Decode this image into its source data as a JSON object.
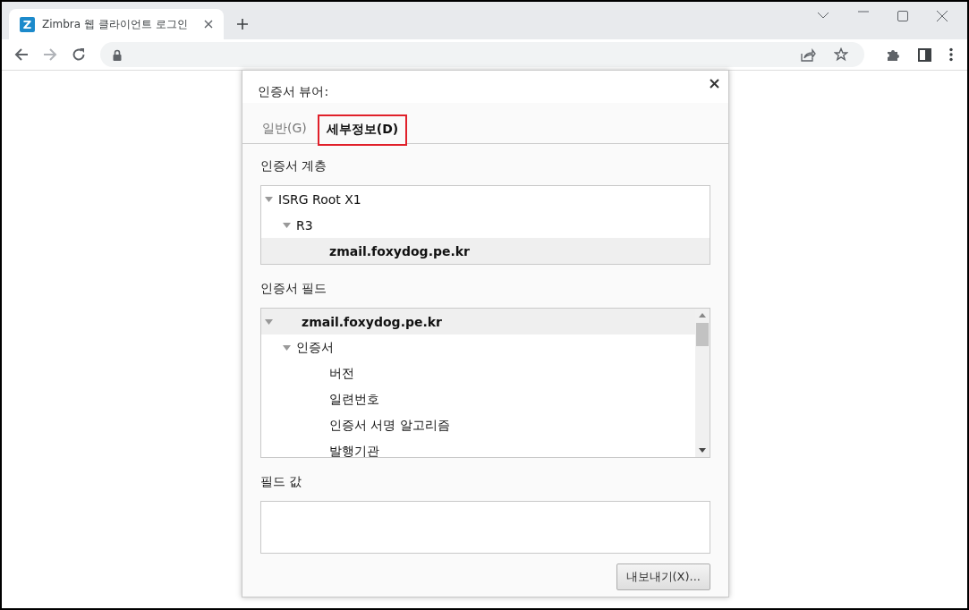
{
  "browser": {
    "tab": {
      "favicon": "Z",
      "title": "Zimbra 웹 클라이언트 로그인",
      "selected": true
    }
  },
  "dialog": {
    "title": "인증서 뷰어:",
    "tabs": [
      {
        "label": "일반(G)",
        "selected": false,
        "highlighted": false
      },
      {
        "label": "세부정보(D)",
        "selected": true,
        "highlighted": true
      }
    ],
    "hierarchy": {
      "label": "인증서 계층",
      "tree": [
        {
          "label": "ISRG Root X1",
          "expanded": true,
          "selected": false,
          "children": [
            {
              "label": "R3",
              "expanded": true,
              "selected": false,
              "children": [
                {
                  "label": "zmail.foxydog.pe.kr",
                  "selected": true
                }
              ]
            }
          ]
        }
      ]
    },
    "fields": {
      "label": "인증서 필드",
      "tree": [
        {
          "label": "zmail.foxydog.pe.kr",
          "expanded": true,
          "selected": true,
          "children": [
            {
              "label": "인증서",
              "expanded": true,
              "selected": false,
              "children": [
                {
                  "label": "버전",
                  "selected": false
                },
                {
                  "label": "일련번호",
                  "selected": false
                },
                {
                  "label": "인증서 서명 알고리즘",
                  "selected": false
                },
                {
                  "label": "발행기관",
                  "selected": false
                }
              ]
            }
          ]
        }
      ]
    },
    "value": {
      "label": "필드 값"
    },
    "export_button": "내보내기(X)..."
  }
}
